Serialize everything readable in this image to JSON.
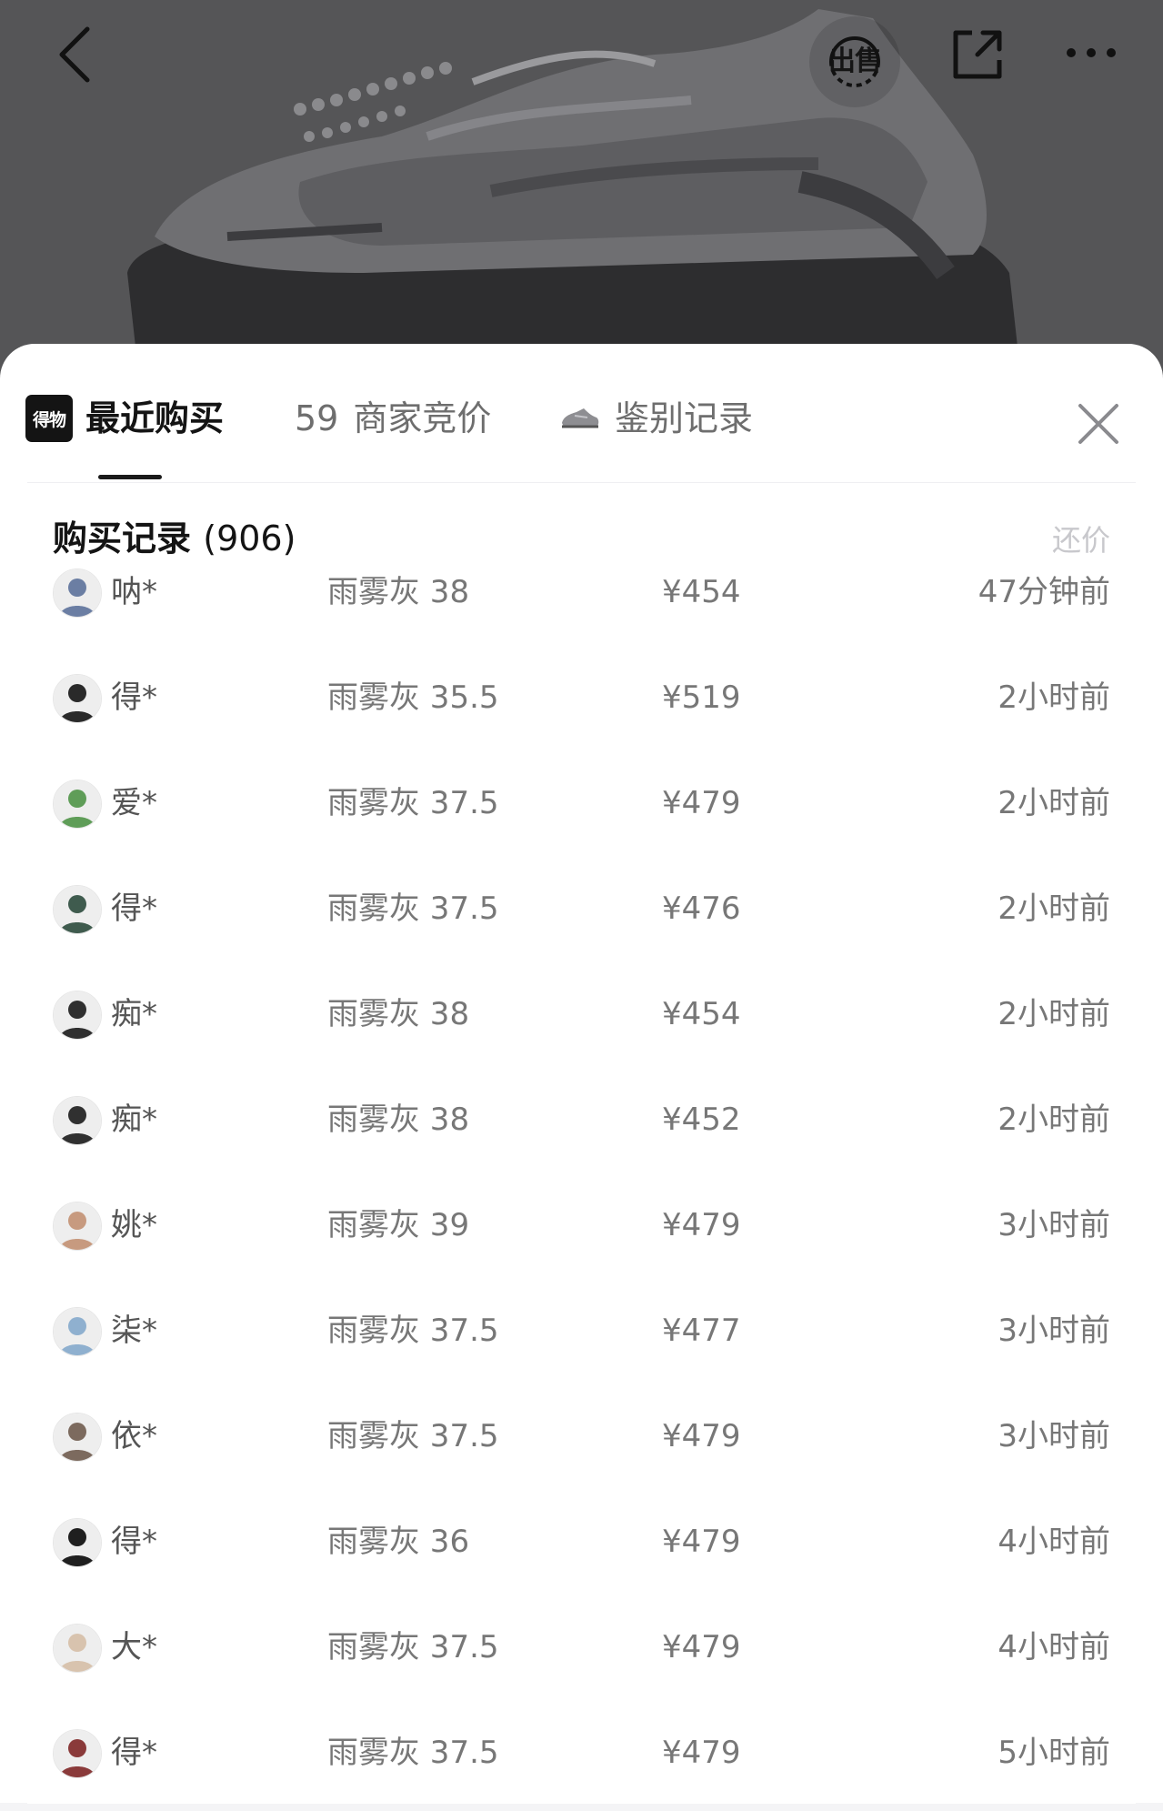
{
  "header": {
    "sell_label": "出售",
    "icons": [
      "back-arrow-icon",
      "share-icon",
      "more-dots-icon"
    ]
  },
  "tabs": {
    "recent": {
      "logo_text": "得物",
      "label": "最近购买"
    },
    "bids": {
      "count": "59",
      "label": "商家竞价"
    },
    "auth": {
      "label": "鉴别记录"
    }
  },
  "records": {
    "title_prefix": "购买记录",
    "count": "906",
    "lp": "(",
    "rp": ")",
    "offer_label": "还价",
    "rows": [
      {
        "buyer": "呐*",
        "spec": "雨雾灰 38",
        "price": "¥454",
        "time": "47分钟前",
        "avatar_color": "#6b7ea3"
      },
      {
        "buyer": "得*",
        "spec": "雨雾灰 35.5",
        "price": "¥519",
        "time": "2小时前",
        "avatar_color": "#2a2a2a"
      },
      {
        "buyer": "爱*",
        "spec": "雨雾灰 37.5",
        "price": "¥479",
        "time": "2小时前",
        "avatar_color": "#5f9d58"
      },
      {
        "buyer": "得*",
        "spec": "雨雾灰 37.5",
        "price": "¥476",
        "time": "2小时前",
        "avatar_color": "#3f5b4e"
      },
      {
        "buyer": "痴*",
        "spec": "雨雾灰 38",
        "price": "¥454",
        "time": "2小时前",
        "avatar_color": "#303030"
      },
      {
        "buyer": "痴*",
        "spec": "雨雾灰 38",
        "price": "¥452",
        "time": "2小时前",
        "avatar_color": "#303030"
      },
      {
        "buyer": "姚*",
        "spec": "雨雾灰 39",
        "price": "¥479",
        "time": "3小时前",
        "avatar_color": "#c79a7f"
      },
      {
        "buyer": "柒*",
        "spec": "雨雾灰 37.5",
        "price": "¥477",
        "time": "3小时前",
        "avatar_color": "#8fb0cf"
      },
      {
        "buyer": "依*",
        "spec": "雨雾灰 37.5",
        "price": "¥479",
        "time": "3小时前",
        "avatar_color": "#7c6a5e"
      },
      {
        "buyer": "得*",
        "spec": "雨雾灰 36",
        "price": "¥479",
        "time": "4小时前",
        "avatar_color": "#1f1f1f"
      },
      {
        "buyer": "大*",
        "spec": "雨雾灰 37.5",
        "price": "¥479",
        "time": "4小时前",
        "avatar_color": "#d8c3ae"
      },
      {
        "buyer": "得*",
        "spec": "雨雾灰 37.5",
        "price": "¥479",
        "time": "5小时前",
        "avatar_color": "#8a3a3a"
      }
    ]
  },
  "colors": {
    "dim_overlay": "#555557",
    "sheet_bg": "#ffffff",
    "text_primary": "#141414",
    "text_secondary": "#777777",
    "muted": "#c8c8cc"
  }
}
